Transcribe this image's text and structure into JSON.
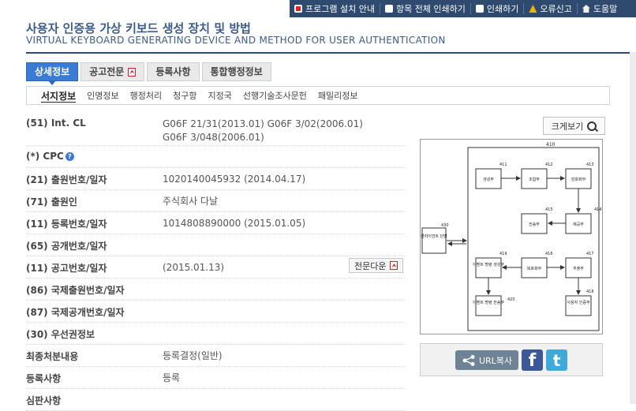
{
  "topbar": {
    "items": [
      {
        "label": "프로그램 설치 안내",
        "icon": "install-icon"
      },
      {
        "label": "항목 전체 인쇄하기",
        "icon": "print-all-icon"
      },
      {
        "label": "인쇄하기",
        "icon": "print-icon"
      },
      {
        "label": "오류신고",
        "icon": "warning-icon"
      },
      {
        "label": "도움말",
        "icon": "help-icon"
      }
    ]
  },
  "title": {
    "korean": "사용자 인증용 가상 키보드 생성 장치 및 방법",
    "english": "VIRTUAL KEYBOARD GENERATING DEVICE AND METHOD FOR USER AUTHENTICATION"
  },
  "tabs": [
    {
      "label": "상세정보",
      "active": true
    },
    {
      "label": "공고전문",
      "pdf": true
    },
    {
      "label": "등록사항"
    },
    {
      "label": "통합행정정보"
    }
  ],
  "subtabs": [
    "서지정보",
    "인명정보",
    "행정처리",
    "청구항",
    "지정국",
    "선행기술조사문헌",
    "패밀리정보"
  ],
  "rows": {
    "ipc": {
      "label": "(51) Int. CL",
      "line1": "G06F 21/31(2013.01) G06F 3/02(2006.01)",
      "line2": "G06F 3/048(2006.01)"
    },
    "cpc": {
      "label": "(*) CPC"
    },
    "app_no": {
      "label": "(21) 출원번호/일자",
      "value": "1020140045932 (2014.04.17)"
    },
    "applicant": {
      "label": "(71) 출원인",
      "value": "주식회사 다날"
    },
    "reg_no": {
      "label": "(11) 등록번호/일자",
      "value": "1014808890000 (2015.01.05)"
    },
    "pub_no": {
      "label": "(65) 공개번호/일자",
      "value": ""
    },
    "notice_no": {
      "label": "(11) 공고번호/일자",
      "value": "(2015.01.13)",
      "button": "전문다운"
    },
    "intl_app": {
      "label": "(86) 국제출원번호/일자",
      "value": ""
    },
    "intl_pub": {
      "label": "(87) 국제공개번호/일자",
      "value": ""
    },
    "priority": {
      "label": "(30) 우선권정보",
      "value": ""
    },
    "final": {
      "label": "최종처분내용",
      "value": "등록결정(일반)"
    },
    "reg_status": {
      "label": "등록사항",
      "value": "등록"
    },
    "trial": {
      "label": "심판사항",
      "value": ""
    }
  },
  "zoom_button": "크게보기",
  "drawing": {
    "labels": {
      "outer": "410",
      "client": "430",
      "b411": "411",
      "b412": "412",
      "b413": "413",
      "b414": "414",
      "b415": "415",
      "b416": "416",
      "b417": "417",
      "b418": "418",
      "b419": "419",
      "b420": "420"
    },
    "boxes": {
      "client": "클라이언트 단말",
      "b411": "생성부",
      "b412": "조합부",
      "b413": "암호화부",
      "b414": "제공부",
      "b415": "전송부",
      "b416": "복호화부",
      "b417": "추출부",
      "b418": "사용자 인증부",
      "b419": "이벤트 명령 생성부",
      "b420": "이벤트 명령 전송부"
    }
  },
  "share": {
    "url_button": "URL복사",
    "facebook_glyph": "f",
    "twitter_glyph": "t"
  }
}
